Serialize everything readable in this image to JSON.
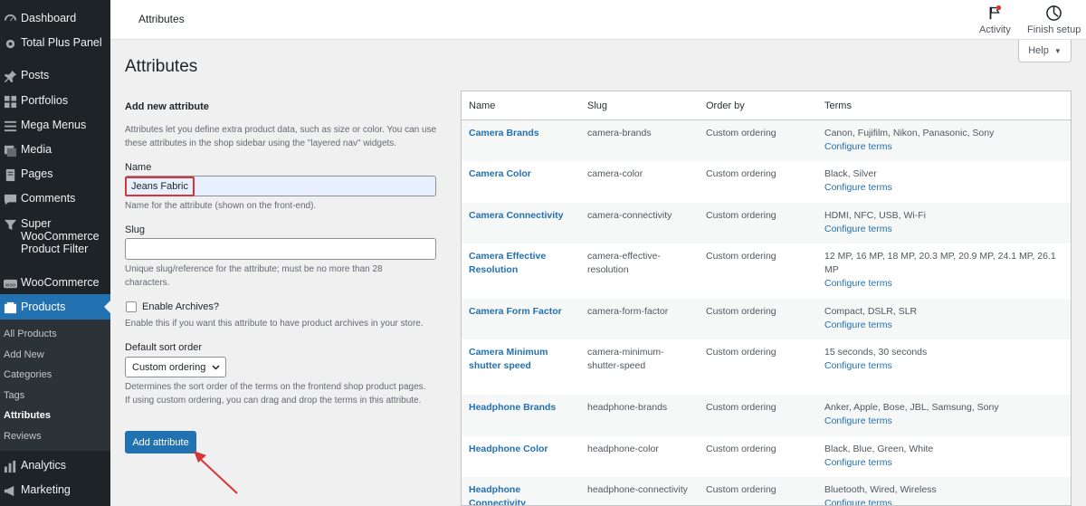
{
  "sidebar": {
    "items": [
      {
        "label": "Dashboard",
        "icon": "dashboard-icon"
      },
      {
        "label": "Total Plus Panel",
        "icon": "gear-icon"
      },
      {
        "label": "Posts",
        "icon": "pin-icon"
      },
      {
        "label": "Portfolios",
        "icon": "grid-icon"
      },
      {
        "label": "Mega Menus",
        "icon": "menu-icon"
      },
      {
        "label": "Media",
        "icon": "media-icon"
      },
      {
        "label": "Pages",
        "icon": "page-icon"
      },
      {
        "label": "Comments",
        "icon": "comment-icon"
      },
      {
        "label": "Super WooCommerce Product Filter",
        "icon": "filter-icon"
      },
      {
        "label": "WooCommerce",
        "icon": "woo-icon"
      },
      {
        "label": "Products",
        "icon": "products-icon"
      },
      {
        "label": "Analytics",
        "icon": "analytics-icon"
      },
      {
        "label": "Marketing",
        "icon": "megaphone-icon"
      }
    ],
    "super_lines": [
      "Super",
      "WooCommerce",
      "Product Filter"
    ],
    "submenu": [
      "All Products",
      "Add New",
      "Categories",
      "Tags",
      "Attributes",
      "Reviews"
    ]
  },
  "topbar": {
    "title": "Attributes",
    "activity": "Activity",
    "finish_setup": "Finish setup"
  },
  "help": "Help",
  "page_title": "Attributes",
  "form": {
    "heading": "Add new attribute",
    "intro": "Attributes let you define extra product data, such as size or color. You can use these attributes in the shop sidebar using the \"layered nav\" widgets.",
    "name_label": "Name",
    "name_value": "Jeans Fabric",
    "name_help": "Name for the attribute (shown on the front-end).",
    "slug_label": "Slug",
    "slug_value": "",
    "slug_help": "Unique slug/reference for the attribute; must be no more than 28 characters.",
    "archives_label": "Enable Archives?",
    "archives_help": "Enable this if you want this attribute to have product archives in your store.",
    "sort_label": "Default sort order",
    "sort_value": "Custom ordering",
    "sort_help": "Determines the sort order of the terms on the frontend shop product pages. If using custom ordering, you can drag and drop the terms in this attribute.",
    "submit": "Add attribute"
  },
  "table": {
    "headers": [
      "Name",
      "Slug",
      "Order by",
      "Terms"
    ],
    "configure": "Configure terms",
    "rows": [
      {
        "name": "Camera Brands",
        "slug": "camera-brands",
        "order": "Custom ordering",
        "terms": "Canon, Fujifilm, Nikon, Panasonic, Sony"
      },
      {
        "name": "Camera Color",
        "slug": "camera-color",
        "order": "Custom ordering",
        "terms": "Black, Silver"
      },
      {
        "name": "Camera Connectivity",
        "slug": "camera-connectivity",
        "order": "Custom ordering",
        "terms": "HDMI, NFC, USB, Wi-Fi"
      },
      {
        "name": "Camera Effective Resolution",
        "slug": "camera-effective-resolution",
        "order": "Custom ordering",
        "terms": "12 MP, 16 MP, 18 MP, 20.3 MP, 20.9 MP, 24.1 MP, 26.1 MP"
      },
      {
        "name": "Camera Form Factor",
        "slug": "camera-form-factor",
        "order": "Custom ordering",
        "terms": "Compact, DSLR, SLR"
      },
      {
        "name": "Camera Minimum shutter speed",
        "slug": "camera-minimum-shutter-speed",
        "order": "Custom ordering",
        "terms": "15 seconds, 30 seconds"
      },
      {
        "name": "Headphone Brands",
        "slug": "headphone-brands",
        "order": "Custom ordering",
        "terms": "Anker, Apple, Bose, JBL, Samsung, Sony"
      },
      {
        "name": "Headphone Color",
        "slug": "headphone-color",
        "order": "Custom ordering",
        "terms": "Black, Blue, Green, White"
      },
      {
        "name": "Headphone Connectivity",
        "slug": "headphone-connectivity",
        "order": "Custom ordering",
        "terms": "Bluetooth, Wired, Wireless"
      }
    ]
  }
}
